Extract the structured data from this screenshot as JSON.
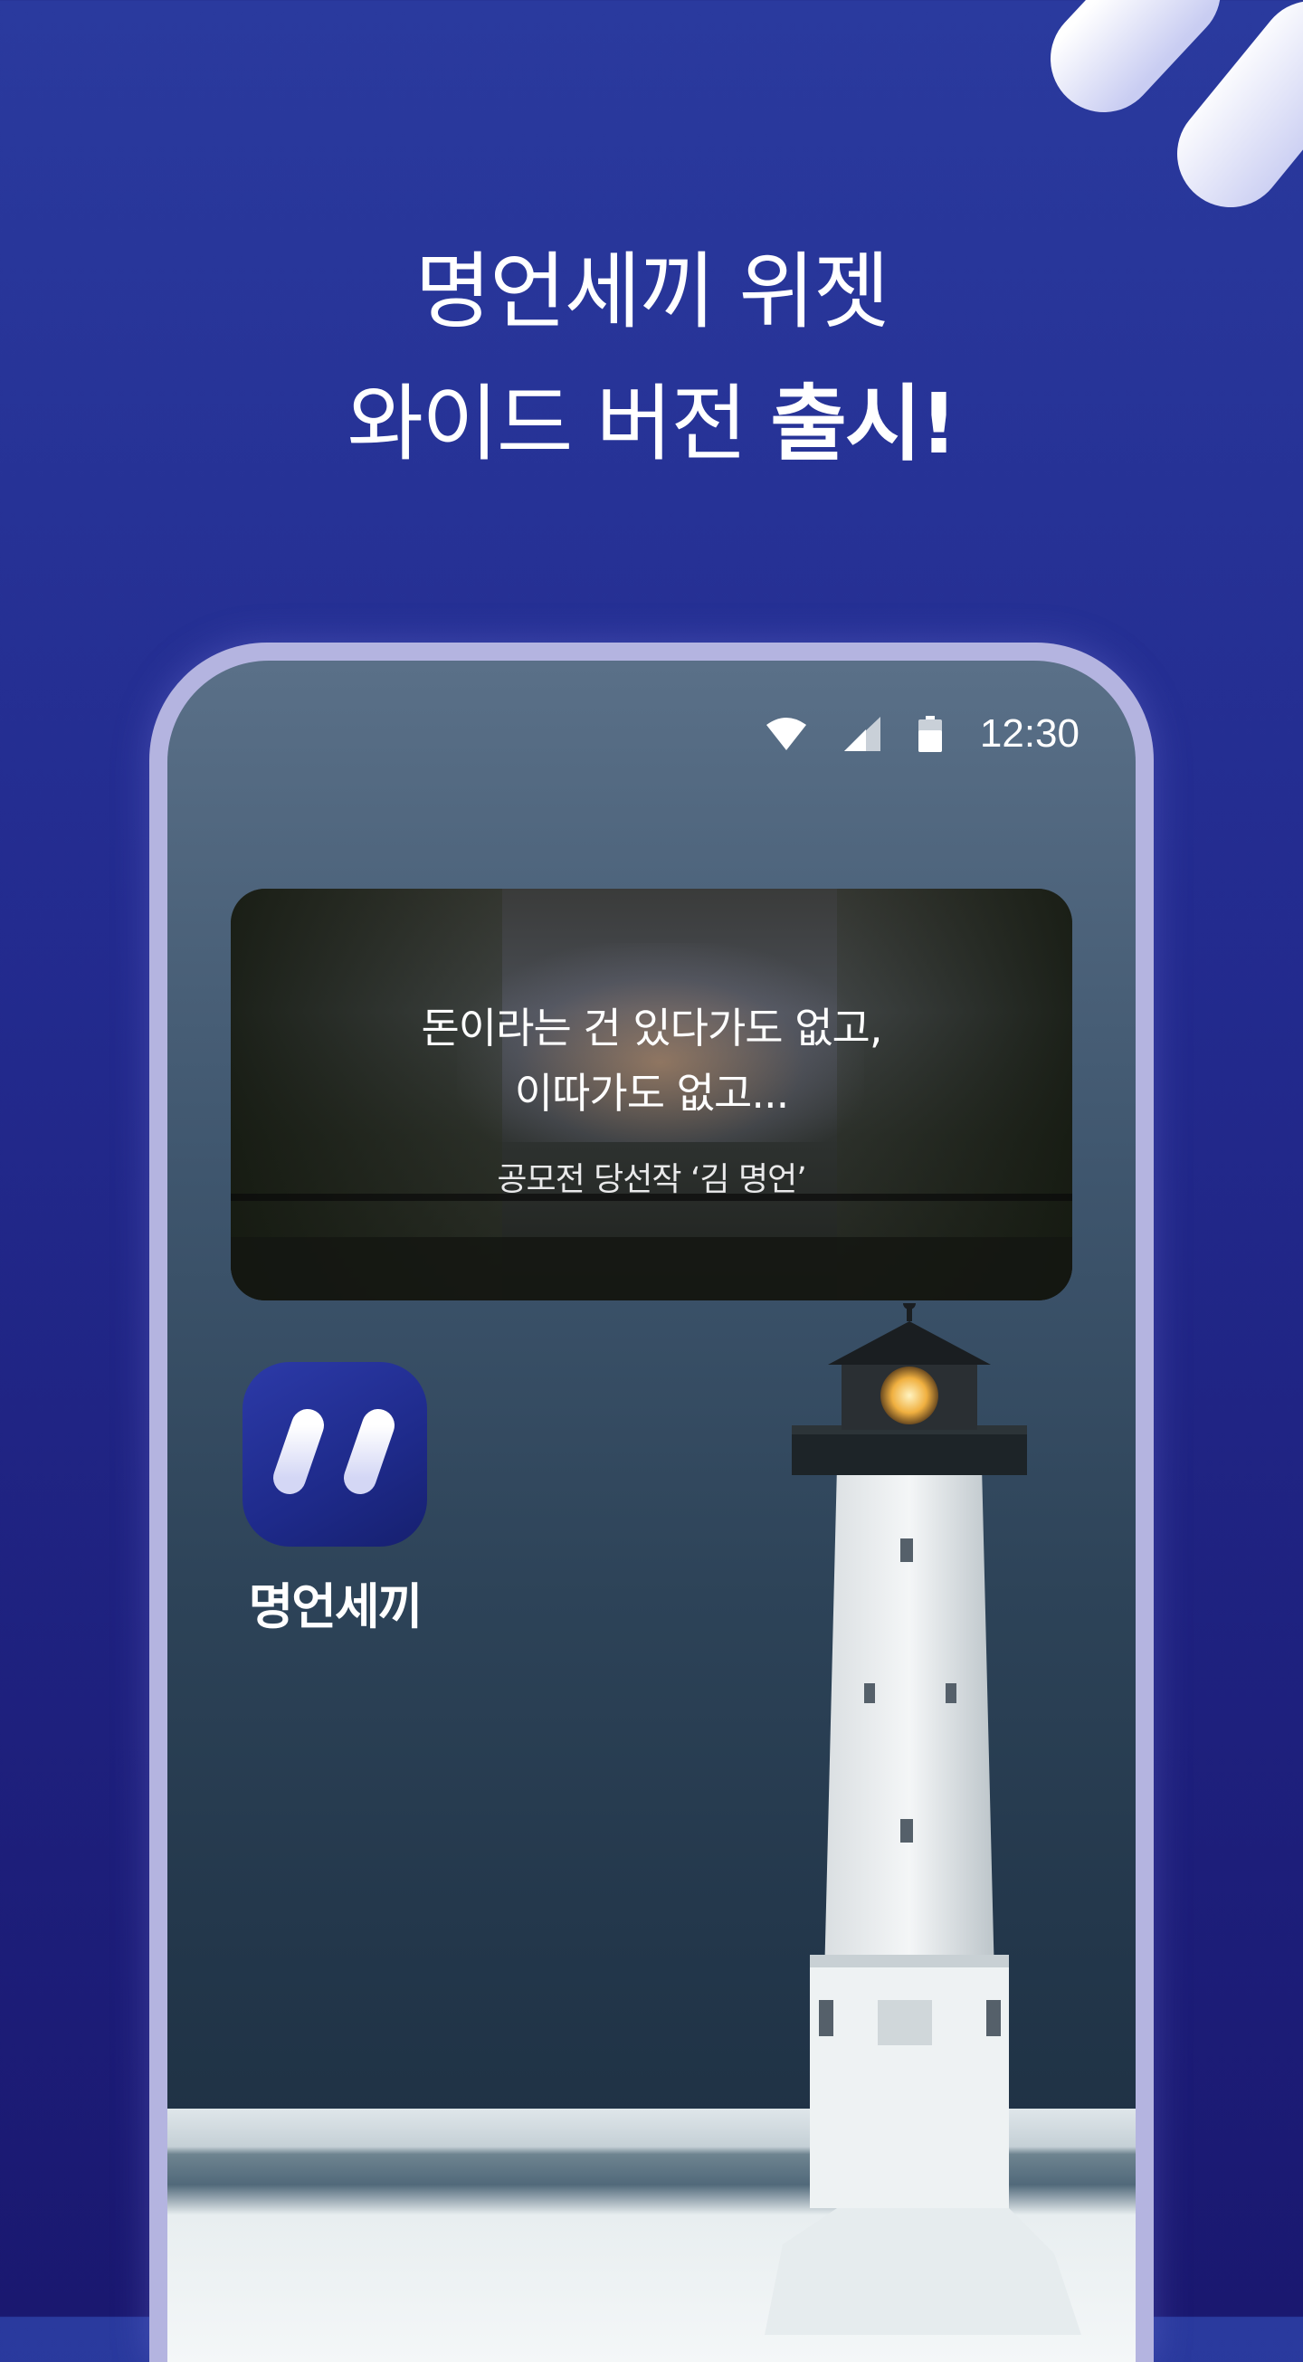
{
  "headline": {
    "line1": "명언세끼 위젯",
    "line2_prefix": "와이드 버전 ",
    "line2_bold": "출시!"
  },
  "status_bar": {
    "time": "12:30",
    "icons": [
      "wifi-icon",
      "signal-icon",
      "battery-icon"
    ]
  },
  "widget": {
    "quote_line1": "돈이라는 건 있다가도 없고,",
    "quote_line2": "이따가도 없고...",
    "author": "공모전 당선작 ‘김 명언’"
  },
  "app": {
    "label": "명언세끼",
    "icon": "quote-logo-icon"
  },
  "colors": {
    "background": "#2a3a9e",
    "frame": "#b4b4e0",
    "text": "#ffffff"
  }
}
